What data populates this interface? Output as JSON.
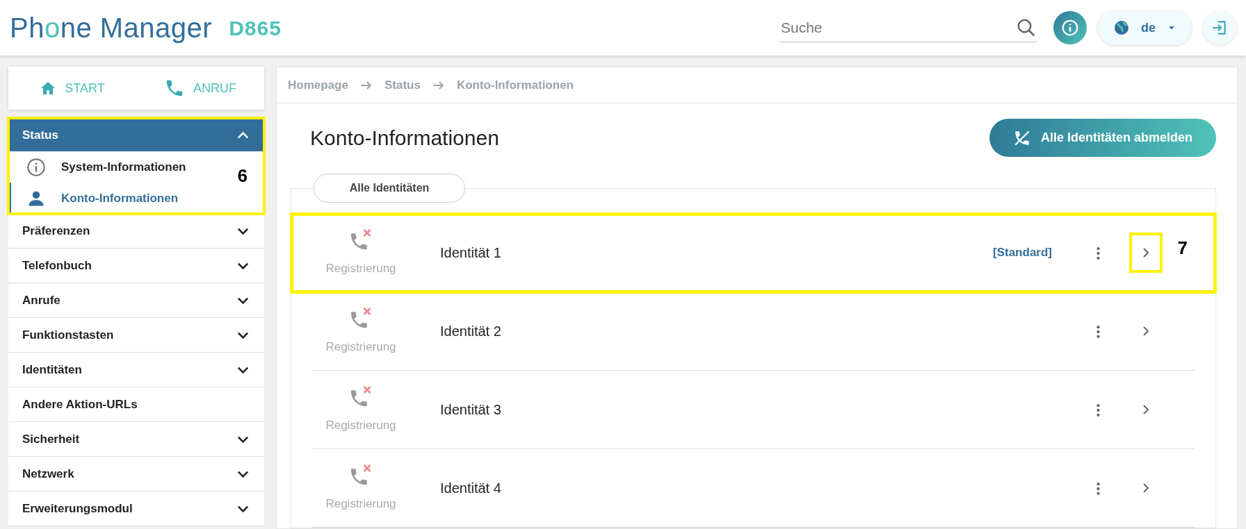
{
  "header": {
    "logo_pre": "Ph",
    "logo_o": "o",
    "logo_post": "ne Manager",
    "model": "D865",
    "search": {
      "placeholder": "Suche"
    },
    "language": "de"
  },
  "shortcuts": [
    "START",
    "ANRUF"
  ],
  "sidebar": {
    "items": [
      {
        "label": "Status",
        "expanded": true,
        "highlighted": true,
        "callout": "6",
        "children": [
          {
            "label": "System-Informationen",
            "kind": "info",
            "selected": false
          },
          {
            "label": "Konto-Informationen",
            "kind": "person",
            "selected": true
          }
        ]
      },
      {
        "label": "Präferenzen",
        "expanded": false
      },
      {
        "label": "Telefonbuch",
        "expanded": false
      },
      {
        "label": "Anrufe",
        "expanded": false
      },
      {
        "label": "Funktionstasten",
        "expanded": false
      },
      {
        "label": "Identitäten",
        "expanded": false
      },
      {
        "label": "Andere Aktion-URLs"
      },
      {
        "label": "Sicherheit",
        "expanded": false
      },
      {
        "label": "Netzwerk",
        "expanded": false
      },
      {
        "label": "Erweiterungsmodul",
        "expanded": false
      }
    ]
  },
  "breadcrumb": [
    "Homepage",
    "Status",
    "Konto-Informationen"
  ],
  "page_title": "Konto-Informationen",
  "action_button": "Alle Identitäten abmelden",
  "tab": "Alle Identitäten",
  "identities": [
    {
      "status": "Registrierung",
      "name": "Identität 1",
      "tag": "[Standard]",
      "highlighted": true,
      "callout": "7"
    },
    {
      "status": "Registrierung",
      "name": "Identität 2",
      "highlighted": false
    },
    {
      "status": "Registrierung",
      "name": "Identität 3",
      "highlighted": false
    },
    {
      "status": "Registrierung",
      "name": "Identität 4",
      "highlighted": false
    }
  ]
}
